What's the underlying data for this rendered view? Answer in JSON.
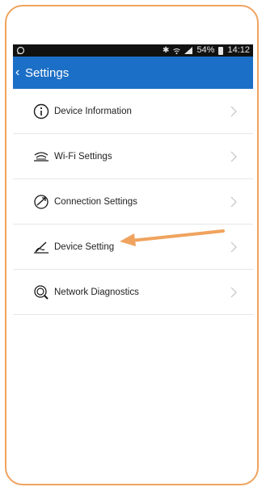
{
  "status_bar": {
    "whatsapp_icon": "whatsapp-icon",
    "bluetooth_icon": "bluetooth-icon",
    "wifi_icon": "wifi-icon",
    "signal_icon": "signal-icon",
    "battery_text": "54%",
    "battery_icon": "battery-icon",
    "time": "14:12"
  },
  "header": {
    "back_icon": "chevron-left-icon",
    "title": "Settings",
    "bg_color": "#1c6fc6"
  },
  "settings_items": [
    {
      "label": "Device Information",
      "icon": "info-circle-icon"
    },
    {
      "label": "Wi-Fi Settings",
      "icon": "wifi-signal-icon"
    },
    {
      "label": "Connection Settings",
      "icon": "link-gauge-icon"
    },
    {
      "label": "Device Setting",
      "icon": "pen-icon"
    },
    {
      "label": "Network Diagnostics",
      "icon": "network-search-icon"
    }
  ],
  "chevron_icon": "chevron-right-icon",
  "annotation": {
    "arrow_color": "#f0a35e",
    "target": "Device Setting"
  },
  "frame_color": "#f0a35e"
}
